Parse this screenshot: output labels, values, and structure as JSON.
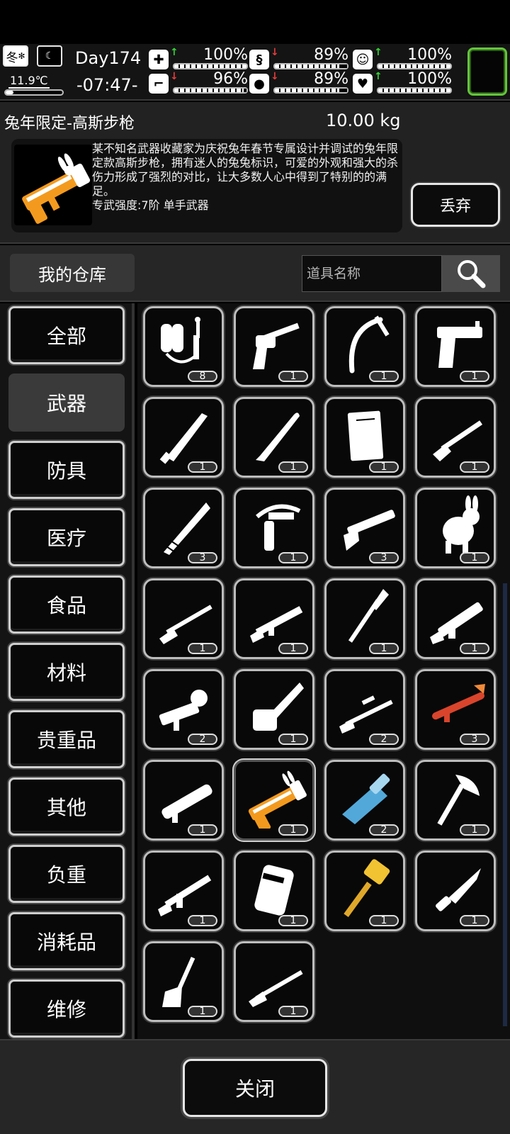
{
  "status": {
    "season": "冬",
    "temperature": "11.9℃",
    "temperature_level": 0.14,
    "day": "Day174",
    "time": "-07:47-",
    "vitals": [
      {
        "icon": "health-icon",
        "arrow": "up",
        "value": "100%",
        "level": 1.0
      },
      {
        "icon": "stomach-icon",
        "arrow": "down",
        "value": "89%",
        "level": 0.89
      },
      {
        "icon": "mood-icon",
        "arrow": "up",
        "value": "100%",
        "level": 1.0
      },
      {
        "icon": "stamina-boot-icon",
        "arrow": "down",
        "value": "96%",
        "level": 0.96
      },
      {
        "icon": "water-drop-icon",
        "arrow": "down",
        "value": "89%",
        "level": 0.89
      },
      {
        "icon": "heart-icon",
        "arrow": "up",
        "value": "100%",
        "level": 1.0
      }
    ],
    "colors": {
      "arrow_up": "#35d435",
      "arrow_down": "#e43c3c",
      "slot_border": "#63c63a"
    }
  },
  "item": {
    "name": "兔年限定-高斯步枪",
    "weight": "10.00 kg",
    "description": "某不知名武器收藏家为庆祝兔年春节专属设计并调试的兔年限定款高斯步枪，拥有迷人的兔兔标识，可爱的外观和强大的杀伤力形成了强烈的对比，让大多数人心中得到了特别的的满足。",
    "grade": "专武强度:7阶 单手武器",
    "discard_label": "丢弃"
  },
  "warehouse": {
    "title": "我的仓库",
    "search_placeholder": "道具名称"
  },
  "categories": [
    "全部",
    "武器",
    "防具",
    "医疗",
    "食品",
    "材料",
    "贵重品",
    "其他",
    "负重",
    "消耗品",
    "维修"
  ],
  "active_category": "武器",
  "items": [
    {
      "icon": "flamethrower-icon",
      "count": "8"
    },
    {
      "icon": "revolver-icon",
      "count": "1"
    },
    {
      "icon": "ice-axe-icon",
      "count": "1"
    },
    {
      "icon": "desert-eagle-pistol-icon",
      "count": "1"
    },
    {
      "icon": "machete-icon",
      "count": "1"
    },
    {
      "icon": "baseball-bat-icon",
      "count": "1"
    },
    {
      "icon": "wooden-board-icon",
      "count": "1"
    },
    {
      "icon": "shotgun-icon",
      "count": "1"
    },
    {
      "icon": "wrapped-blade-icon",
      "count": "3"
    },
    {
      "icon": "crossbow-icon",
      "count": "1"
    },
    {
      "icon": "pump-shotgun-icon",
      "count": "3"
    },
    {
      "icon": "rabbit-plush-icon",
      "count": "1"
    },
    {
      "icon": "hunting-rifle-icon",
      "count": "1"
    },
    {
      "icon": "assault-rifle-icon",
      "count": "1"
    },
    {
      "icon": "spear-icon",
      "count": "1"
    },
    {
      "icon": "tactical-rifle-icon",
      "count": "1"
    },
    {
      "icon": "grenade-launcher-icon",
      "count": "2"
    },
    {
      "icon": "chainsaw-icon",
      "count": "1"
    },
    {
      "icon": "sniper-rifle-icon",
      "count": "2"
    },
    {
      "icon": "red-rocket-launcher-icon",
      "count": "3"
    },
    {
      "icon": "rocket-launcher-icon",
      "count": "1"
    },
    {
      "icon": "rabbit-gauss-rifle-icon",
      "count": "1",
      "selected": true
    },
    {
      "icon": "blue-minigun-icon",
      "count": "2"
    },
    {
      "icon": "hatchet-icon",
      "count": "1"
    },
    {
      "icon": "battle-rifle-icon",
      "count": "1"
    },
    {
      "icon": "riot-shield-icon",
      "count": "1"
    },
    {
      "icon": "golden-hammer-icon",
      "count": "1"
    },
    {
      "icon": "combat-knife-icon",
      "count": "1"
    },
    {
      "icon": "shovel-icon",
      "count": "1"
    },
    {
      "icon": "lever-rifle-icon",
      "count": "1"
    }
  ],
  "close_label": "关闭"
}
